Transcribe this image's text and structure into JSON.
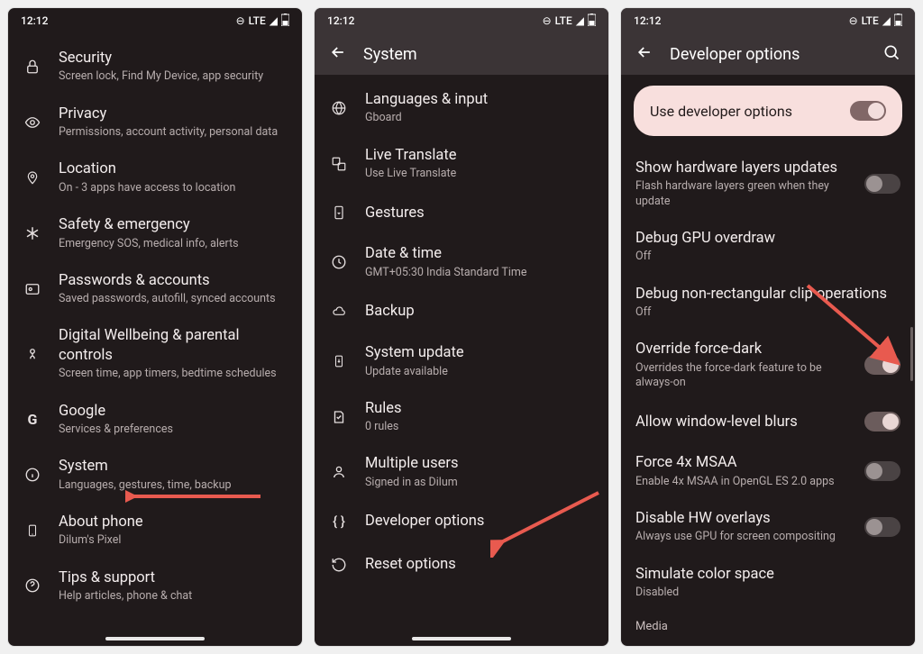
{
  "status": {
    "time": "12:12",
    "net": "LTE"
  },
  "screen1": {
    "items": [
      {
        "icon": "lock",
        "title": "Security",
        "sub": "Screen lock, Find My Device, app security"
      },
      {
        "icon": "eye",
        "title": "Privacy",
        "sub": "Permissions, account activity, personal data"
      },
      {
        "icon": "pin",
        "title": "Location",
        "sub": "On - 3 apps have access to location"
      },
      {
        "icon": "asterisk",
        "title": "Safety & emergency",
        "sub": "Emergency SOS, medical info, alerts"
      },
      {
        "icon": "key",
        "title": "Passwords & accounts",
        "sub": "Saved passwords, autofill, synced accounts"
      },
      {
        "icon": "heart",
        "title": "Digital Wellbeing & parental controls",
        "sub": "Screen time, app timers, bedtime schedules"
      },
      {
        "icon": "google",
        "title": "Google",
        "sub": "Services & preferences"
      },
      {
        "icon": "info",
        "title": "System",
        "sub": "Languages, gestures, time, backup"
      },
      {
        "icon": "phone",
        "title": "About phone",
        "sub": "Dilum's Pixel"
      },
      {
        "icon": "help",
        "title": "Tips & support",
        "sub": "Help articles, phone & chat"
      }
    ]
  },
  "screen2": {
    "header": "System",
    "items": [
      {
        "icon": "globe",
        "title": "Languages & input",
        "sub": "Gboard"
      },
      {
        "icon": "translate",
        "title": "Live Translate",
        "sub": "Use Live Translate"
      },
      {
        "icon": "gesture",
        "title": "Gestures"
      },
      {
        "icon": "clock",
        "title": "Date & time",
        "sub": "GMT+05:30 India Standard Time"
      },
      {
        "icon": "cloud",
        "title": "Backup"
      },
      {
        "icon": "update",
        "title": "System update",
        "sub": "Update available"
      },
      {
        "icon": "rules",
        "title": "Rules",
        "sub": "0 rules"
      },
      {
        "icon": "user",
        "title": "Multiple users",
        "sub": "Signed in as Dilum"
      },
      {
        "icon": "braces",
        "title": "Developer options"
      },
      {
        "icon": "reset",
        "title": "Reset options"
      }
    ]
  },
  "screen3": {
    "header": "Developer options",
    "card": "Use developer options",
    "items": [
      {
        "title": "Show hardware layers updates",
        "sub": "Flash hardware layers green when they update",
        "toggle": "off"
      },
      {
        "title": "Debug GPU overdraw",
        "sub": "Off"
      },
      {
        "title": "Debug non-rectangular clip operations",
        "sub": "Off"
      },
      {
        "title": "Override force-dark",
        "sub": "Overrides the force-dark feature to be always-on",
        "toggle": "on"
      },
      {
        "title": "Allow window-level blurs",
        "toggle": "on"
      },
      {
        "title": "Force 4x MSAA",
        "sub": "Enable 4x MSAA in OpenGL ES 2.0 apps",
        "toggle": "off"
      },
      {
        "title": "Disable HW overlays",
        "sub": "Always use GPU for screen compositing",
        "toggle": "off"
      },
      {
        "title": "Simulate color space",
        "sub": "Disabled"
      }
    ],
    "section": "Media"
  }
}
